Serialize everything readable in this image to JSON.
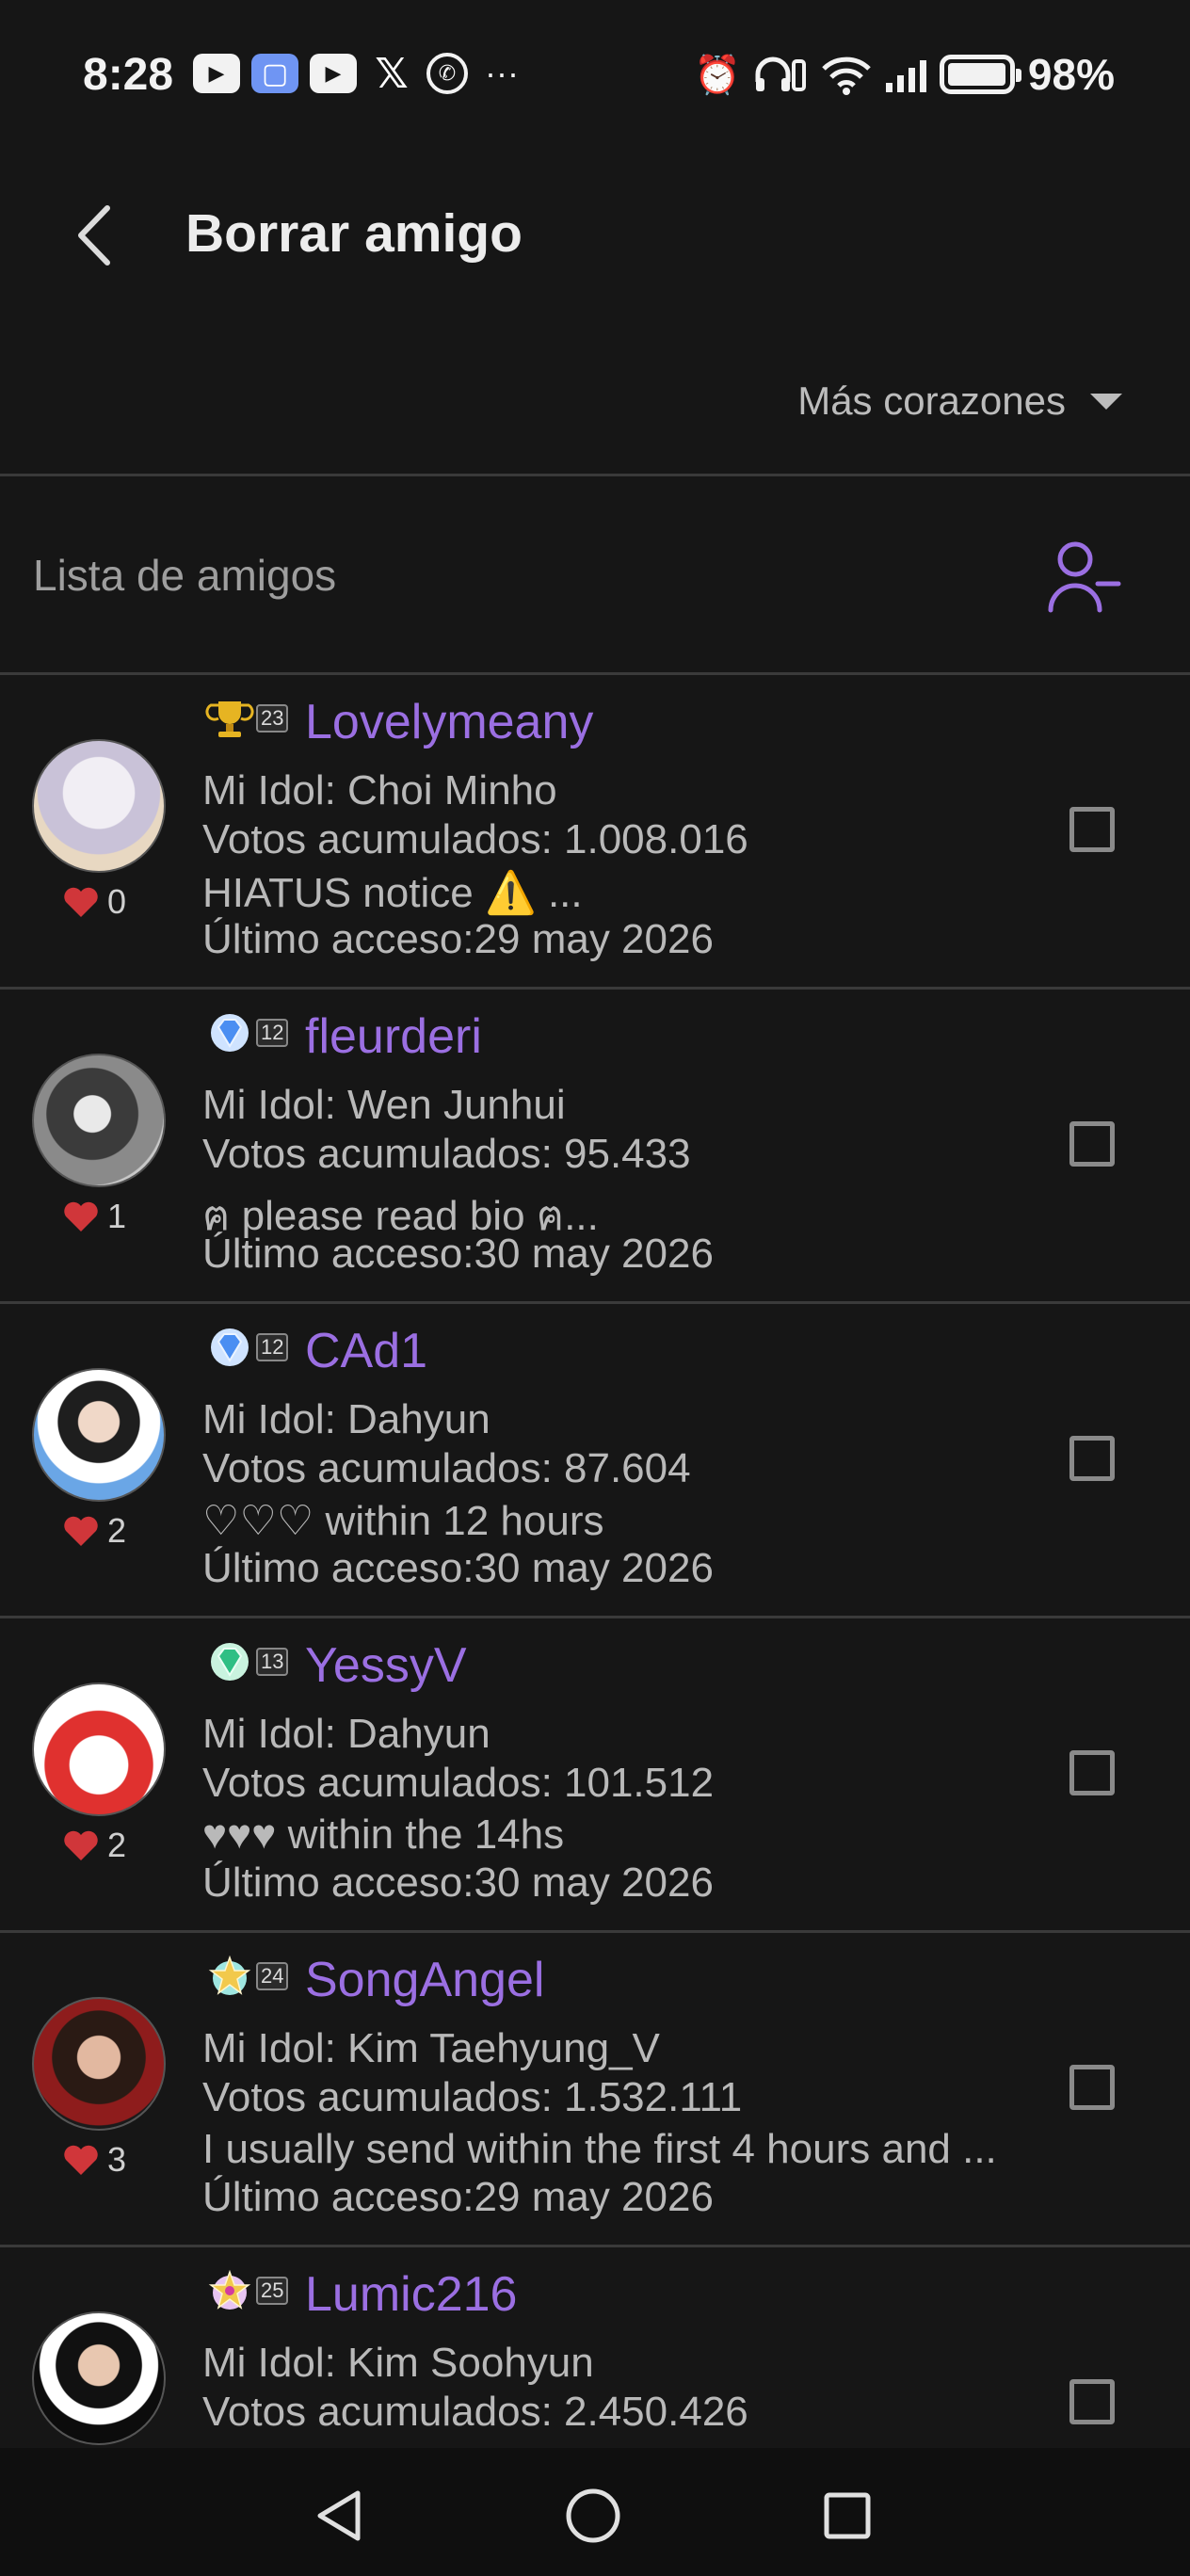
{
  "status_bar": {
    "time": "8:28",
    "battery_pct": "98%",
    "battery_level": 0.98,
    "notif_icons": [
      "youtube-icon",
      "app-icon",
      "youtube-icon",
      "x-icon",
      "whatsapp-icon"
    ],
    "more": "···"
  },
  "header": {
    "title": "Borrar amigo",
    "back_icon": "chevron-left-icon"
  },
  "sort": {
    "label": "Más corazones"
  },
  "list": {
    "title": "Lista de amigos",
    "remove_icon": "person-minus-icon"
  },
  "colors": {
    "background": "#161616",
    "accent_purple": "#9b6fe2",
    "heart_red": "#d0363a",
    "text_gray": "#b9b9b9"
  },
  "friends": [
    {
      "name": "Lovelymeany",
      "level": "23",
      "badge": "trophy-badge-icon",
      "idol": "Mi Idol: Choi Minho",
      "votes": "Votos acumulados: 1.008.016",
      "bio": "HIATUS notice ⚠️ ...",
      "last": "Último acceso:29 may 2026",
      "hearts": "0"
    },
    {
      "name": "fleurderi",
      "level": "12",
      "badge": "diamond-badge-icon",
      "idol": "Mi Idol: Wen Junhui",
      "votes": "Votos acumulados: 95.433",
      "bio": "ฅ please read bio ฅ...",
      "last": "Último acceso:30 may 2026",
      "hearts": "1"
    },
    {
      "name": "CAd1",
      "level": "12",
      "badge": "diamond-badge-icon",
      "idol": "Mi Idol: Dahyun",
      "votes": "Votos acumulados: 87.604",
      "bio": "♡♡♡ within 12 hours",
      "last": "Último acceso:30 may 2026",
      "hearts": "2"
    },
    {
      "name": "YessyV",
      "level": "13",
      "badge": "emerald-badge-icon",
      "idol": "Mi Idol: Dahyun",
      "votes": "Votos acumulados: 101.512",
      "bio": "♥♥♥ within the 14hs",
      "last": "Último acceso:30 may 2026",
      "hearts": "2"
    },
    {
      "name": "SongAngel",
      "level": "24",
      "badge": "star-badge-icon",
      "idol": "Mi Idol: Kim Taehyung_V",
      "votes": "Votos acumulados: 1.532.111",
      "bio": "I usually send within the first 4 hours and ...",
      "last": "Último acceso:29 may 2026",
      "hearts": "3"
    },
    {
      "name": "Lumic216",
      "level": "25",
      "badge": "crown-badge-icon",
      "idol": "Mi Idol: Kim Soohyun",
      "votes": "Votos acumulados: 2.450.426",
      "bio": "",
      "last": "",
      "hearts": ""
    }
  ],
  "navbar": {
    "back": "triangle-back-icon",
    "home": "circle-home-icon",
    "recents": "square-recents-icon"
  }
}
